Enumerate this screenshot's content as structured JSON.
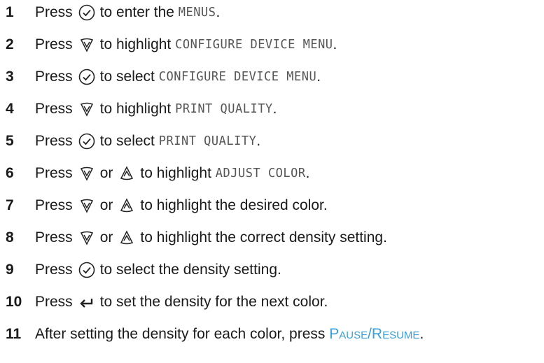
{
  "steps": [
    {
      "num": "1",
      "a": "Press",
      "b": "to enter the",
      "lcd": "MENUS",
      "end": "."
    },
    {
      "num": "2",
      "a": "Press",
      "b": "to highlight",
      "lcd": "CONFIGURE DEVICE MENU",
      "end": "."
    },
    {
      "num": "3",
      "a": "Press",
      "b": "to select",
      "lcd": "CONFIGURE DEVICE MENU",
      "end": "."
    },
    {
      "num": "4",
      "a": "Press",
      "b": "to highlight",
      "lcd": "PRINT QUALITY",
      "end": "."
    },
    {
      "num": "5",
      "a": "Press",
      "b": "to select",
      "lcd": "PRINT QUALITY",
      "end": "."
    },
    {
      "num": "6",
      "a": "Press",
      "or": "or",
      "b": "to highlight",
      "lcd": "ADJUST COLOR",
      "end": "."
    },
    {
      "num": "7",
      "a": "Press",
      "or": "or",
      "b": "to highlight the desired color."
    },
    {
      "num": "8",
      "a": "Press",
      "or": "or",
      "b": "to highlight the correct density setting."
    },
    {
      "num": "9",
      "a": "Press",
      "b": "to select the density setting."
    },
    {
      "num": "10",
      "a": "Press",
      "b": "to set the density for the next color."
    },
    {
      "num": "11",
      "a": "After setting the density for each color, press",
      "key": "Pause/Resume",
      "end": "."
    }
  ],
  "icons": {
    "select": "select-check-icon",
    "down": "down-arrow-icon",
    "up": "up-arrow-icon",
    "back": "back-arrow-icon"
  },
  "colors": {
    "key_text": "#3a9fd8"
  }
}
